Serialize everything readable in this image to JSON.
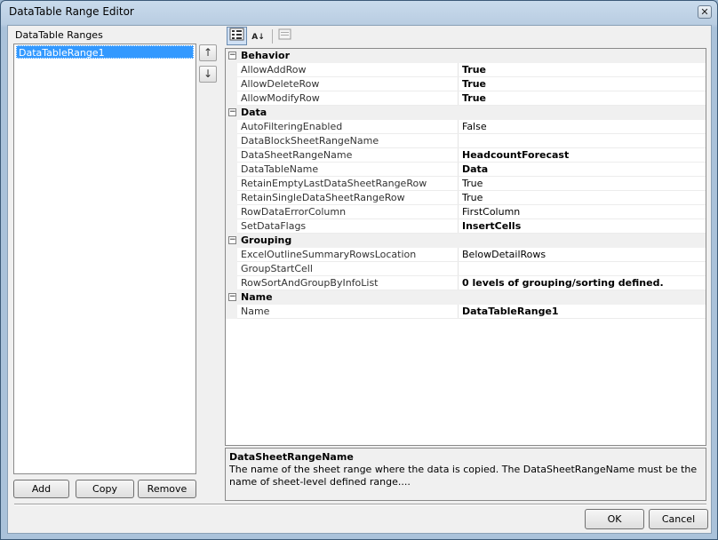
{
  "window": {
    "title": "DataTable Range Editor",
    "close_glyph": "✕"
  },
  "ranges": {
    "label": "DataTable Ranges",
    "items": [
      "DataTableRange1"
    ],
    "add_label": "Add",
    "copy_label": "Copy",
    "remove_label": "Remove"
  },
  "move_buttons": {
    "up_glyph": "↑",
    "down_glyph": "↓"
  },
  "toolbar": {
    "categorized_icon": "categorized-icon",
    "alphabetical_icon": "alphabetical-icon",
    "property_pages_icon": "property-pages-icon",
    "alphabetical_glyph": "A↓"
  },
  "grid": {
    "categories": [
      {
        "name": "Behavior",
        "toggle": "−",
        "rows": [
          {
            "name": "AllowAddRow",
            "value": "True",
            "bold": true
          },
          {
            "name": "AllowDeleteRow",
            "value": "True",
            "bold": true
          },
          {
            "name": "AllowModifyRow",
            "value": "True",
            "bold": true
          }
        ]
      },
      {
        "name": "Data",
        "toggle": "−",
        "rows": [
          {
            "name": "AutoFilteringEnabled",
            "value": "False",
            "bold": false
          },
          {
            "name": "DataBlockSheetRangeName",
            "value": "",
            "bold": false
          },
          {
            "name": "DataSheetRangeName",
            "value": "HeadcountForecast",
            "bold": true
          },
          {
            "name": "DataTableName",
            "value": "Data",
            "bold": true
          },
          {
            "name": "RetainEmptyLastDataSheetRangeRow",
            "value": "True",
            "bold": false
          },
          {
            "name": "RetainSingleDataSheetRangeRow",
            "value": "True",
            "bold": false
          },
          {
            "name": "RowDataErrorColumn",
            "value": "FirstColumn",
            "bold": false
          },
          {
            "name": "SetDataFlags",
            "value": "InsertCells",
            "bold": true
          }
        ]
      },
      {
        "name": "Grouping",
        "toggle": "−",
        "rows": [
          {
            "name": "ExcelOutlineSummaryRowsLocation",
            "value": "BelowDetailRows",
            "bold": false
          },
          {
            "name": "GroupStartCell",
            "value": "",
            "bold": false
          },
          {
            "name": "RowSortAndGroupByInfoList",
            "value": "0 levels of grouping/sorting defined.",
            "bold": true
          }
        ]
      },
      {
        "name": "Name",
        "toggle": "−",
        "rows": [
          {
            "name": "Name",
            "value": "DataTableRange1",
            "bold": true
          }
        ]
      }
    ]
  },
  "description": {
    "title": "DataSheetRangeName",
    "text": "The name of the sheet range where the data is copied.  The DataSheetRangeName must be the name of sheet-level defined range...."
  },
  "dialog": {
    "ok_label": "OK",
    "cancel_label": "Cancel"
  },
  "colors": {
    "selection": "#3399ff",
    "panel": "#f0f0f0",
    "frame": "#b9cde2"
  }
}
